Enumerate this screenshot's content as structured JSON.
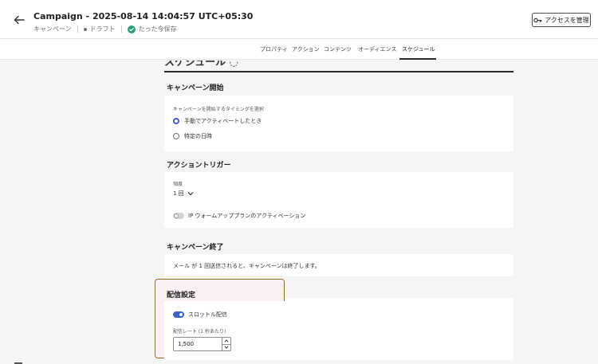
{
  "header": {
    "title": "Campaign - 2025-08-14 14:04:57 UTC+05:30",
    "type_label": "キャンペーン",
    "status_label": "ドラフト",
    "save_status": "たった今保存",
    "access_button": "アクセスを管理"
  },
  "tabs": [
    {
      "label": "プロパティ"
    },
    {
      "label": "アクション"
    },
    {
      "label": "コンテンツ"
    },
    {
      "label": "オーディエンス"
    },
    {
      "label": "スケジュール",
      "active": true
    }
  ],
  "schedule": {
    "section_title": "スケジュール",
    "campaign_start": {
      "title": "キャンペーン開始",
      "prompt": "キャンペーンを開始するタイミングを選択",
      "options": [
        {
          "label": "手動でアクティベートしたとき",
          "selected": true
        },
        {
          "label": "特定の日時",
          "selected": false
        }
      ]
    },
    "action_trigger": {
      "title": "アクショントリガー",
      "frequency_label": "頻度",
      "frequency_value": "1 回",
      "ip_warmup_label": "IP ウォームアッププランのアクティベーション",
      "ip_warmup_on": false
    },
    "campaign_end": {
      "title": "キャンペーン終了",
      "text": "メール が 1 回送信されると、キャンペーンは終了します。"
    },
    "delivery_settings": {
      "title": "配信設定",
      "throttle_label": "スロットル配信",
      "throttle_on": true,
      "rate_label": "配信レート (1 秒あたり)",
      "rate_value": "1,500"
    }
  },
  "colors": {
    "accent": "#3b63c9",
    "highlight_border": "#9a6a2a",
    "highlight_fill": "#fbf1f5",
    "saved_check": "#2d9d78"
  }
}
